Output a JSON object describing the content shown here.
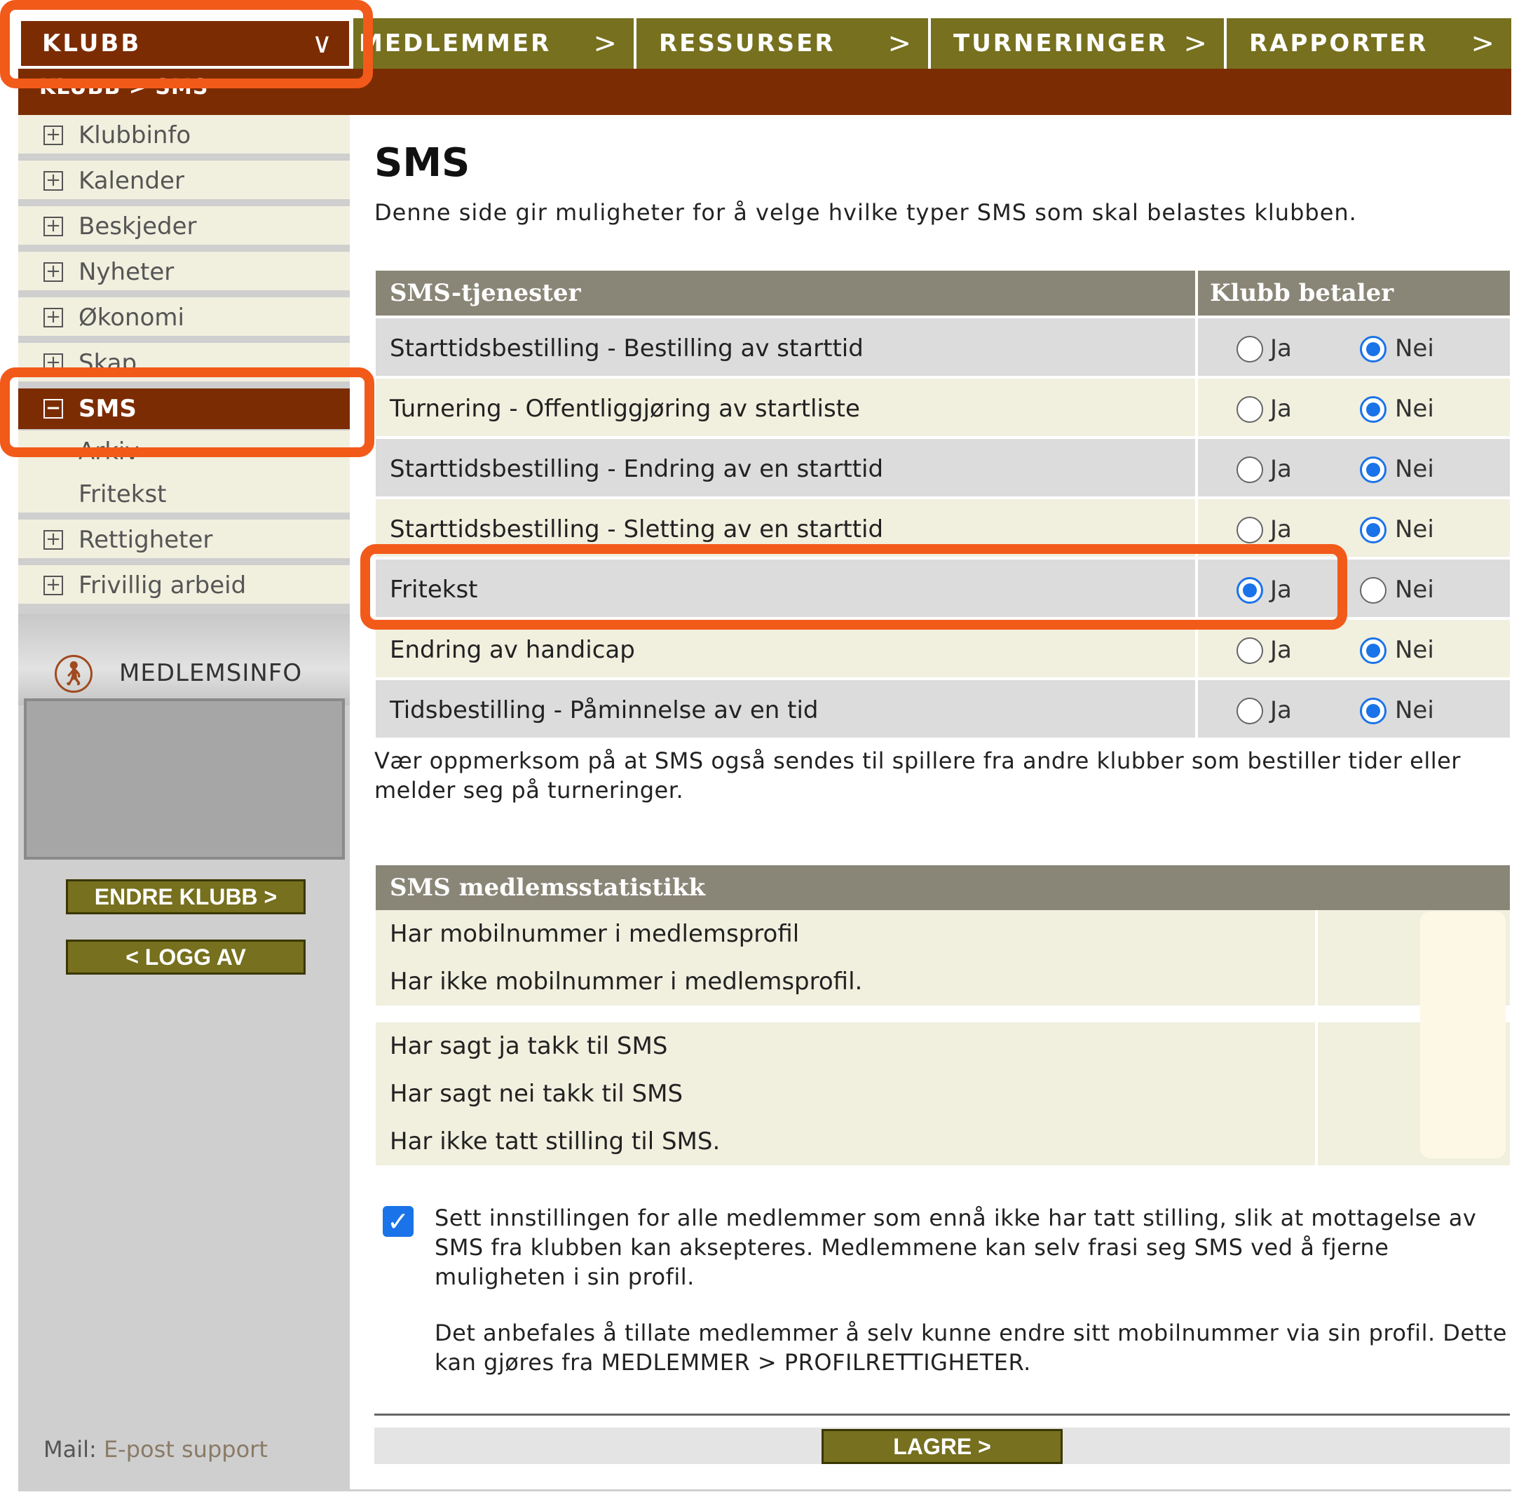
{
  "nav": {
    "items": [
      {
        "label": "KLUBB",
        "icon": "chevron-down-icon",
        "glyph": "∨",
        "active": true
      },
      {
        "label": "MEDLEMMER",
        "icon": "chevron-right-icon",
        "glyph": ">",
        "active": false
      },
      {
        "label": "RESSURSER",
        "icon": "chevron-right-icon",
        "glyph": ">",
        "active": false
      },
      {
        "label": "TURNERINGER",
        "icon": "chevron-right-icon",
        "glyph": ">",
        "active": false
      },
      {
        "label": "RAPPORTER",
        "icon": "chevron-right-icon",
        "glyph": ">",
        "active": false
      }
    ]
  },
  "breadcrumb": "KLUBB > SMS",
  "sidebar": {
    "items": [
      {
        "label": "Klubbinfo",
        "icon": "plus-box-icon"
      },
      {
        "label": "Kalender",
        "icon": "plus-box-icon"
      },
      {
        "label": "Beskjeder",
        "icon": "plus-box-icon"
      },
      {
        "label": "Nyheter",
        "icon": "plus-box-icon"
      },
      {
        "label": "Økonomi",
        "icon": "plus-box-icon"
      },
      {
        "label": "Skap",
        "icon": "plus-box-icon"
      },
      {
        "label": "SMS",
        "icon": "minus-box-icon",
        "active": true
      }
    ],
    "sub_items": [
      "Arkiv",
      "Fritekst"
    ],
    "items_after": [
      {
        "label": "Rettigheter",
        "icon": "plus-box-icon"
      },
      {
        "label": "Frivillig arbeid",
        "icon": "plus-box-icon"
      }
    ],
    "member_info_label": "MEDLEMSINFO",
    "change_club_button": "ENDRE KLUBB >",
    "logout_button": "< LOGG AV",
    "mail_label": "Mail:",
    "mail_link": "E-post support"
  },
  "main": {
    "title": "SMS",
    "intro": "Denne side gir muligheter for å velge hvilke typer SMS som skal belastes klubben.",
    "services_table": {
      "col_service": "SMS-tjenester",
      "col_pays": "Klubb betaler",
      "yes_label": "Ja",
      "no_label": "Nei",
      "rows": [
        {
          "label": "Starttidsbestilling - Bestilling av starttid",
          "value": "Nei"
        },
        {
          "label": "Turnering - Offentliggjøring av startliste",
          "value": "Nei"
        },
        {
          "label": "Starttidsbestilling - Endring av en starttid",
          "value": "Nei"
        },
        {
          "label": "Starttidsbestilling - Sletting av en starttid",
          "value": "Nei"
        },
        {
          "label": "Fritekst",
          "value": "Ja"
        },
        {
          "label": "Endring av handicap",
          "value": "Nei"
        },
        {
          "label": "Tidsbestilling - Påminnelse av en tid",
          "value": "Nei"
        }
      ]
    },
    "note": "Vær oppmerksom på at SMS også sendes til spillere fra andre klubber som bestiller tider eller melder seg på turneringer.",
    "stats_table": {
      "header": "SMS medlemsstatistikk",
      "group1": [
        "Har mobilnummer i medlemsprofil",
        "Har ikke mobilnummer i medlemsprofil."
      ],
      "group2": [
        "Har sagt ja takk til SMS",
        "Har sagt nei takk til SMS",
        "Har ikke tatt stilling til SMS."
      ]
    },
    "consent_checked": true,
    "consent_text": "Sett innstillingen for alle medlemmer som ennå ikke har tatt stilling, slik at mottagelse av SMS fra klubben kan aksepteres. Medlemmene kan selv frasi seg SMS ved å fjerne muligheten i sin profil.",
    "recommend_text": "Det anbefales å tillate medlemmer å selv kunne endre sitt mobilnummer via sin profil. Dette kan gjøres fra MEDLEMMER > PROFILRETTIGHETER.",
    "save_button": "LAGRE >"
  },
  "colors": {
    "brand_dark": "#7c2c02",
    "olive": "#76701f",
    "highlight": "#f25a1a",
    "radio_selected": "#1a73e8"
  }
}
